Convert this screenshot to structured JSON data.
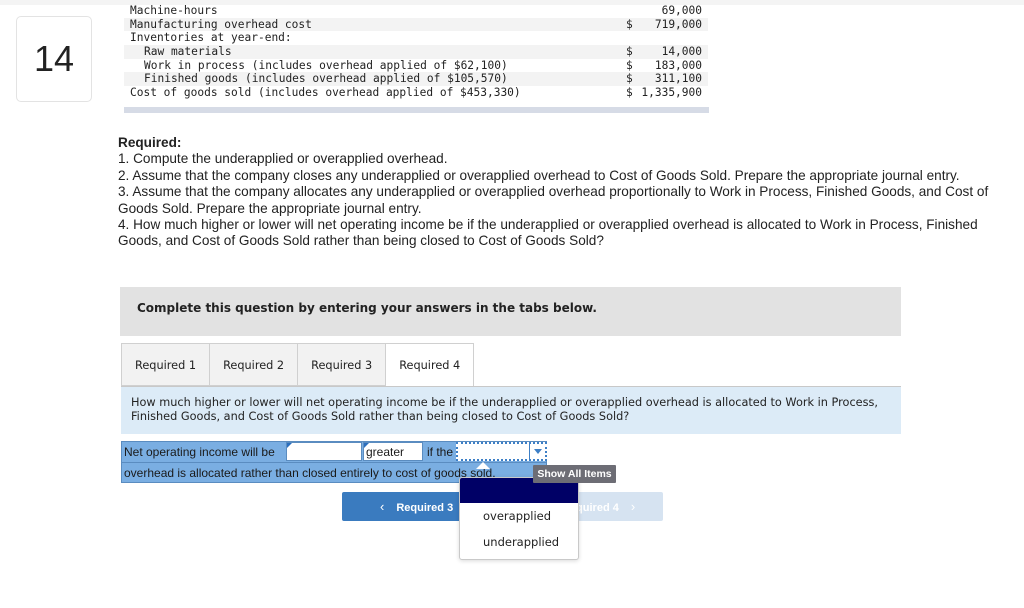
{
  "question_number": "14",
  "data_table": {
    "rows": [
      {
        "label": "Machine-hours",
        "currency": "",
        "amount": "69,000",
        "indent": false
      },
      {
        "label": "Manufacturing overhead cost",
        "currency": "$",
        "amount": "719,000",
        "indent": false
      },
      {
        "label": "Inventories at year-end:",
        "currency": "",
        "amount": "",
        "indent": false
      },
      {
        "label": "Raw materials",
        "currency": "$",
        "amount": "14,000",
        "indent": true
      },
      {
        "label": "Work in process (includes overhead applied of $62,100)",
        "currency": "$",
        "amount": "183,000",
        "indent": true
      },
      {
        "label": "Finished goods (includes overhead applied of $105,570)",
        "currency": "$",
        "amount": "311,100",
        "indent": true
      },
      {
        "label": "Cost of goods sold (includes overhead applied of $453,330)",
        "currency": "$",
        "amount": "1,335,900",
        "indent": false
      }
    ]
  },
  "required": {
    "heading": "Required:",
    "items": [
      "1. Compute the underapplied or overapplied overhead.",
      "2. Assume that the company closes any underapplied or overapplied overhead to Cost of Goods Sold. Prepare the appropriate journal entry.",
      "3. Assume that the company allocates any underapplied or overapplied overhead proportionally to Work in Process, Finished Goods, and Cost of Goods Sold. Prepare the appropriate journal entry.",
      "4. How much higher or lower will net operating income be if the underapplied or overapplied overhead is allocated to Work in Process, Finished Goods, and Cost of Goods Sold rather than being closed to Cost of Goods Sold?"
    ]
  },
  "instruction": "Complete this question by entering your answers in the tabs below.",
  "tabs": [
    {
      "label": "Required 1",
      "active": false
    },
    {
      "label": "Required 2",
      "active": false
    },
    {
      "label": "Required 3",
      "active": false
    },
    {
      "label": "Required 4",
      "active": true
    }
  ],
  "question_text": "How much higher or lower will net operating income be if the underapplied or overapplied overhead is allocated to Work in Process, Finished Goods, and Cost of Goods Sold rather than being closed to Cost of Goods Sold?",
  "answer": {
    "prefix": "Net operating income will be",
    "amount_value": "",
    "comparison_value": "greater",
    "if_the": "if the",
    "dropdown_value": "",
    "suffix": "overhead is allocated rather than closed entirely to cost of goods sold."
  },
  "tooltip": "Show All Items",
  "dropdown_options": [
    "overapplied",
    "underapplied"
  ],
  "nav": {
    "prev_label": "Required 3",
    "next_label": "Required 4",
    "prev_chevron": "‹",
    "next_chevron": "›"
  }
}
